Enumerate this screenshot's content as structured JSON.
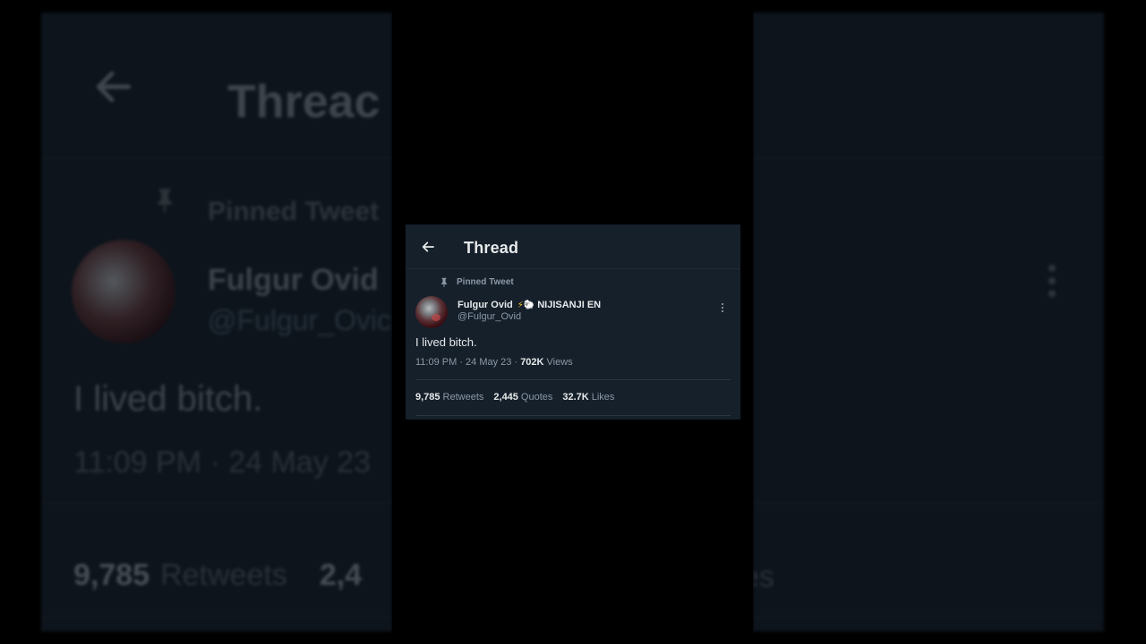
{
  "header": {
    "title": "Thread",
    "back_icon": "arrow-left-icon"
  },
  "pinned": {
    "label": "Pinned Tweet",
    "icon": "pin-icon"
  },
  "author": {
    "name": "Fulgur Ovid",
    "badges": "⚡🐑",
    "affiliation": "NIJISANJI EN",
    "handle": "@Fulgur_Ovid"
  },
  "tweet": {
    "text": "I lived bitch.",
    "time": "11:09 PM · 24 May 23 · ",
    "views_count": "702K",
    "views_label": " Views"
  },
  "stats": {
    "retweets_count": "9,785",
    "retweets_label": "Retweets",
    "quotes_count": "2,445",
    "quotes_label": "Quotes",
    "likes_count": "32.7K",
    "likes_label": "Likes"
  },
  "background": {
    "title_partial": "Threac",
    "pinned_partial": "Pinned Tweet",
    "name_partial": "Fulgur Ovid",
    "handle_partial": "@Fulgur_Ovic",
    "time_partial": "11:09 PM · 24 May 23",
    "stats_partial_count": "9,785",
    "stats_partial_label": "Retweets",
    "stats_partial_count2": "2,4",
    "likes_partial": "es"
  },
  "colors": {
    "card_bg": "#15202b",
    "text": "#e7e9ea",
    "muted": "#8b98a5"
  }
}
